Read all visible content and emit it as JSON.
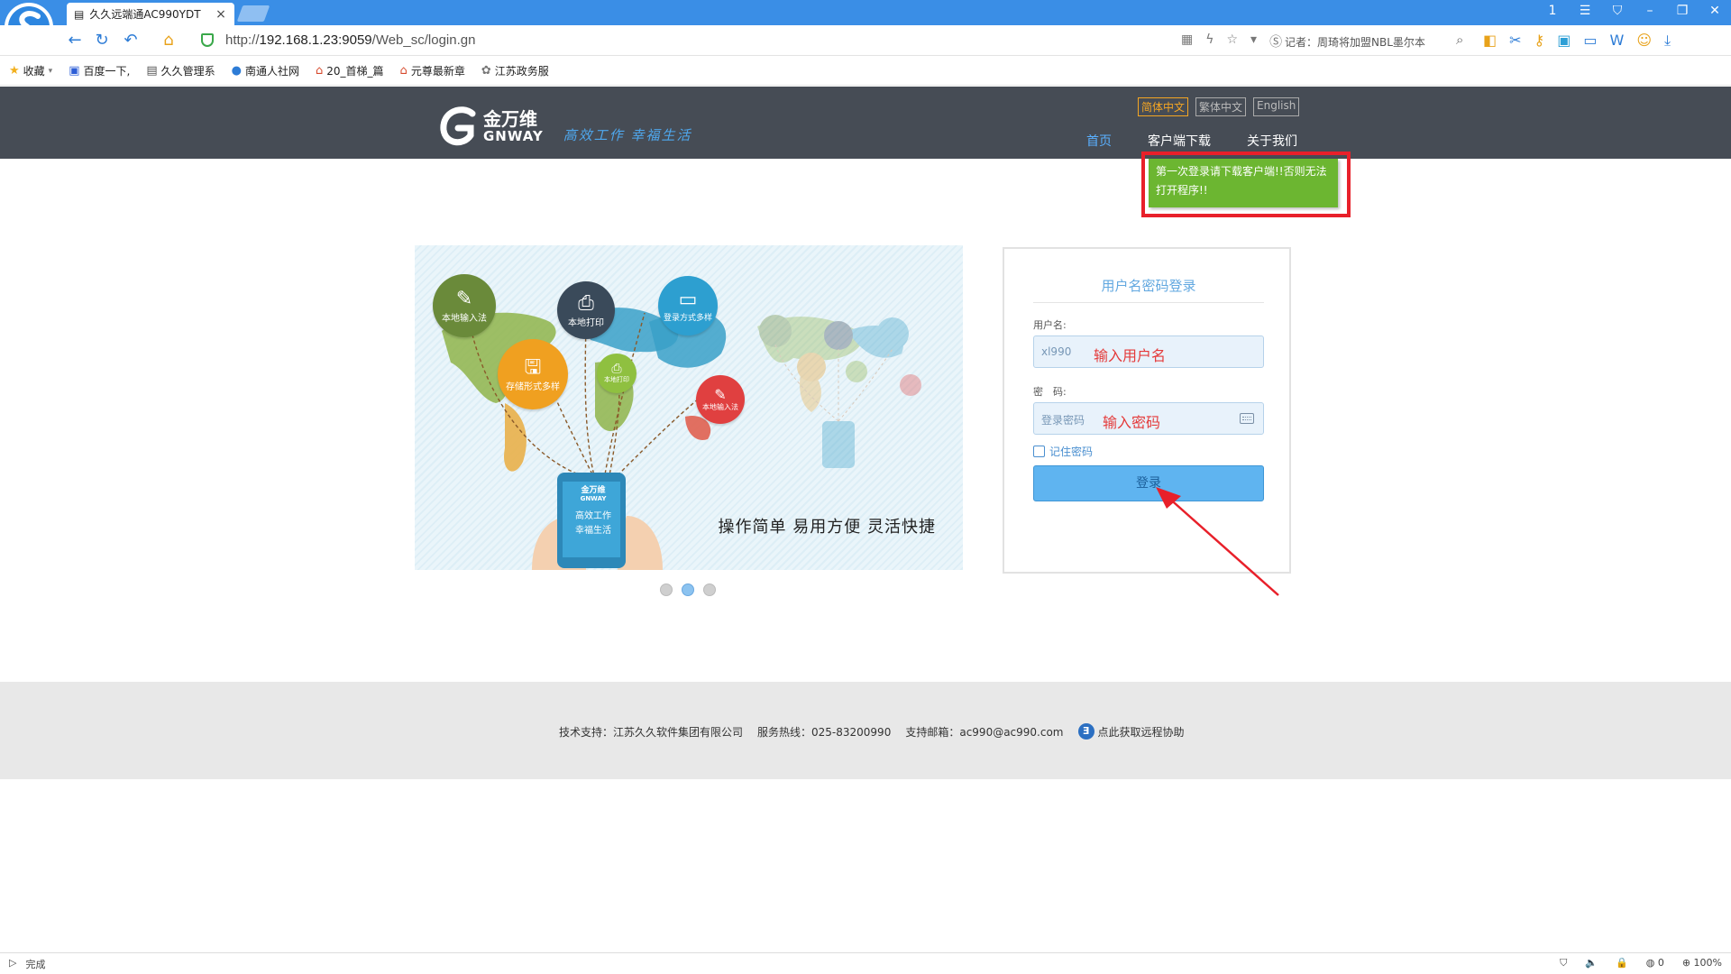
{
  "browser": {
    "tab_title": "久久远端通AC990YDT",
    "tab_close": "×",
    "url_prefix": "http://",
    "url_host": "192.168.1.23:9059",
    "url_path": "/Web_sc/login.gn",
    "news_ticker": "记者：周琦将加盟NBL墨尔本",
    "window_controls": [
      "1",
      "☰",
      "⛉",
      "–",
      "❐",
      "✕"
    ],
    "nav_icons": [
      "back-icon",
      "refresh-icon",
      "undo-icon",
      "home-icon"
    ]
  },
  "bookmarks": [
    {
      "label": "收藏",
      "icon": "★"
    },
    {
      "label": "百度一下,",
      "icon": "▣"
    },
    {
      "label": "久久管理系",
      "icon": "▤"
    },
    {
      "label": "南通人社网",
      "icon": "●"
    },
    {
      "label": "20_首梯_篇",
      "icon": "⌂"
    },
    {
      "label": "元尊最新章",
      "icon": "⌂"
    },
    {
      "label": "江苏政务服",
      "icon": "✿"
    }
  ],
  "header": {
    "logo_cn": "金万维",
    "logo_en": "GNWAY",
    "slogan": "高效工作 幸福生活",
    "languages": [
      "简体中文",
      "繁体中文",
      "English"
    ],
    "nav": [
      "首页",
      "客户端下载",
      "关于我们"
    ]
  },
  "tooltip": {
    "text": "第一次登录请下载客户端!!否则无法打开程序!!"
  },
  "banner": {
    "caption": "操作简单  易用方便  灵活快捷",
    "bubbles": [
      "本地输入法",
      "本地打印",
      "登录方式多样",
      "存储形式多样",
      "本地打印",
      "本地输入法"
    ],
    "device_text": "高效工作 幸福生活",
    "device_logo_cn": "金万维",
    "device_logo_en": "GNWAY",
    "slides": 3,
    "active_slide": 2
  },
  "login": {
    "title": "用户名密码登录",
    "username_label": "用户名:",
    "username_value": "xl990",
    "username_note": "输入用户名",
    "password_label": "密　码:",
    "password_placeholder": "登录密码",
    "password_note": "输入密码",
    "remember_label": "记住密码",
    "login_button": "登录"
  },
  "footer": {
    "support": "技术支持：江苏久久软件集团有限公司",
    "hotline": "服务热线：025-83200990",
    "email": "支持邮箱：ac990@ac990.com",
    "remote_help": "点此获取远程协助"
  },
  "status": {
    "left": "完成",
    "counter": "0",
    "zoom": "100%"
  },
  "colors": {
    "accent": "#3a8ee6",
    "header_bg": "#464c55",
    "tooltip_bg": "#6cb631",
    "annotation_red": "#e8202a",
    "login_button": "#5fb4f0"
  }
}
